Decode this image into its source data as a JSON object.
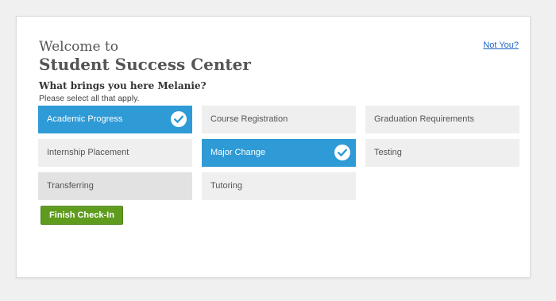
{
  "header": {
    "welcome": "Welcome to",
    "center_name": "Student Success Center",
    "not_you_link": "Not You?"
  },
  "prompt": {
    "question": "What brings you here Melanie?",
    "hint": "Please select all that apply."
  },
  "options": [
    {
      "label": "Academic Progress",
      "selected": true
    },
    {
      "label": "Course Registration",
      "selected": false
    },
    {
      "label": "Graduation Requirements",
      "selected": false
    },
    {
      "label": "Internship Placement",
      "selected": false
    },
    {
      "label": "Major Change",
      "selected": true
    },
    {
      "label": "Testing",
      "selected": false
    },
    {
      "label": "Transferring",
      "selected": false
    },
    {
      "label": "Tutoring",
      "selected": false
    }
  ],
  "actions": {
    "finish_label": "Finish Check-In"
  },
  "colors": {
    "selected_tile": "#2e9ad6",
    "unselected_tile": "#efefef",
    "finish_button": "#5f9c1e",
    "link": "#1e64c8"
  },
  "icons": {
    "selected_check": "check-circle-icon"
  }
}
